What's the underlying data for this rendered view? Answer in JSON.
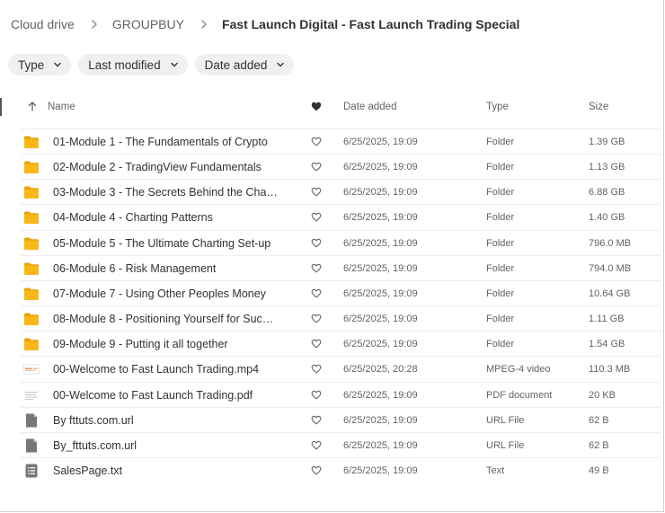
{
  "breadcrumb": {
    "root": "Cloud drive",
    "parent": "GROUPBUY",
    "current": "Fast Launch Digital - Fast Launch Trading Special"
  },
  "filters": {
    "type": "Type",
    "last_modified": "Last modified",
    "date_added": "Date added"
  },
  "columns": {
    "name": "Name",
    "date_added": "Date added",
    "type": "Type",
    "size": "Size"
  },
  "colors": {
    "folder": "#f9b81a",
    "folder_dark": "#e8a307",
    "generic_file": "#72777c",
    "pdf_lines": "#c5c7c9",
    "video_accent": "#f58a3a"
  },
  "files": [
    {
      "name": "01-Module 1 - The Fundamentals of Crypto",
      "date": "6/25/2025, 19:09",
      "type": "Folder",
      "size": "1.39 GB",
      "icon": "folder-icon"
    },
    {
      "name": "02-Module 2 - TradingView Fundamentals",
      "date": "6/25/2025, 19:09",
      "type": "Folder",
      "size": "1.13 GB",
      "icon": "folder-icon"
    },
    {
      "name": "03-Module 3 - The Secrets Behind the Cha…",
      "date": "6/25/2025, 19:09",
      "type": "Folder",
      "size": "6.88 GB",
      "icon": "folder-icon"
    },
    {
      "name": "04-Module 4 - Charting Patterns",
      "date": "6/25/2025, 19:09",
      "type": "Folder",
      "size": "1.40 GB",
      "icon": "folder-icon"
    },
    {
      "name": "05-Module 5 - The Ultimate Charting Set-up",
      "date": "6/25/2025, 19:09",
      "type": "Folder",
      "size": "796.0 MB",
      "icon": "folder-icon"
    },
    {
      "name": "06-Module 6 - Risk Management",
      "date": "6/25/2025, 19:09",
      "type": "Folder",
      "size": "794.0 MB",
      "icon": "folder-icon"
    },
    {
      "name": "07-Module 7 - Using Other Peoples Money",
      "date": "6/25/2025, 19:09",
      "type": "Folder",
      "size": "10.64 GB",
      "icon": "folder-icon"
    },
    {
      "name": "08-Module 8 - Positioning Yourself for Suc…",
      "date": "6/25/2025, 19:09",
      "type": "Folder",
      "size": "1.11 GB",
      "icon": "folder-icon"
    },
    {
      "name": "09-Module 9 - Putting it all together",
      "date": "6/25/2025, 19:09",
      "type": "Folder",
      "size": "1.54 GB",
      "icon": "folder-icon"
    },
    {
      "name": "00-Welcome to Fast Launch Trading.mp4",
      "date": "6/25/2025, 20:28",
      "type": "MPEG-4 video",
      "size": "110.3 MB",
      "icon": "video-thumbnail-icon"
    },
    {
      "name": "00-Welcome to Fast Launch Trading.pdf",
      "date": "6/25/2025, 19:09",
      "type": "PDF document",
      "size": "20 KB",
      "icon": "pdf-thumbnail-icon"
    },
    {
      "name": "By fttuts.com.url",
      "date": "6/25/2025, 19:09",
      "type": "URL File",
      "size": "62 B",
      "icon": "generic-file-icon"
    },
    {
      "name": "By_fttuts.com.url",
      "date": "6/25/2025, 19:09",
      "type": "URL File",
      "size": "62 B",
      "icon": "generic-file-icon"
    },
    {
      "name": "SalesPage.txt",
      "date": "6/25/2025, 19:09",
      "type": "Text",
      "size": "49 B",
      "icon": "text-file-icon"
    }
  ]
}
